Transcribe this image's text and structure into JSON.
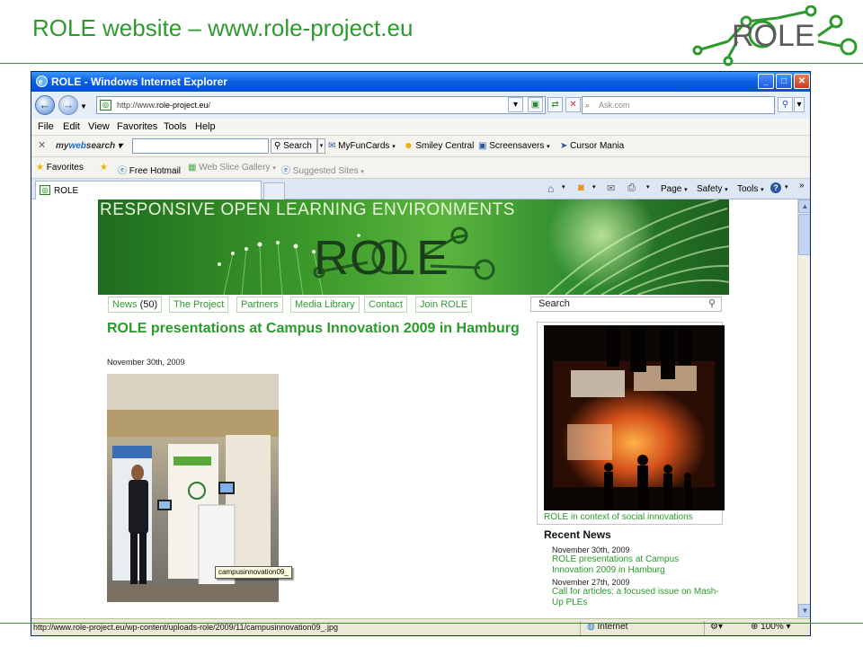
{
  "slide": {
    "title": "ROLE website – www.role-project.eu",
    "logo_text": "ROLE"
  },
  "window": {
    "title": "ROLE - Windows Internet Explorer",
    "controls": [
      "minimize",
      "maximize",
      "close"
    ]
  },
  "address_bar": {
    "url_prefix": "http://www.",
    "url_domain": "role-project.eu",
    "url_suffix": "/",
    "search_placeholder": "Ask.com"
  },
  "menu": {
    "items": [
      "File",
      "Edit",
      "View",
      "Favorites",
      "Tools",
      "Help"
    ]
  },
  "mywebsearch_bar": {
    "brand_my": "my",
    "brand_web": "web",
    "brand_search": "search",
    "search_button": "Search",
    "links": [
      "MyFunCards",
      "Smiley Central",
      "Screensavers",
      "Cursor Mania"
    ]
  },
  "favorites_bar": {
    "favorites_label": "Favorites",
    "items": [
      "Free Hotmail",
      "Web Slice Gallery",
      "Suggested Sites"
    ]
  },
  "tab_bar": {
    "active_tab": "ROLE",
    "commands": [
      "Page",
      "Safety",
      "Tools"
    ]
  },
  "webpage": {
    "banner_tagline": "RESPONSIVE OPEN LEARNING ENVIRONMENTS",
    "banner_logo": "ROLE",
    "nav": [
      {
        "label": "News",
        "count": "(50)"
      },
      {
        "label": "The Project"
      },
      {
        "label": "Partners"
      },
      {
        "label": "Media Library"
      },
      {
        "label": "Contact"
      },
      {
        "label": "Join ROLE"
      }
    ],
    "search_label": "Search",
    "post": {
      "title": "ROLE presentations at Campus Innovation 2009 in Hamburg",
      "date": "November 30th, 2009",
      "image_tooltip": "campusinnovation09_"
    },
    "sidebar": {
      "image_caption": "ROLE in context of social innovations",
      "recent_news_heading": "Recent News",
      "recent_news": [
        {
          "date": "November 30th, 2009",
          "title": "ROLE presentations at Campus Innovation 2009 in Hamburg"
        },
        {
          "date": "November 27th, 2009",
          "title": "Call for articles: a focused issue on Mash-Up PLEs"
        }
      ]
    }
  },
  "status_bar": {
    "url": "http://www.role-project.eu/wp-content/uploads-role/2009/11/campusinnovation09_.jpg",
    "zone": "Internet",
    "zoom": "100%"
  }
}
